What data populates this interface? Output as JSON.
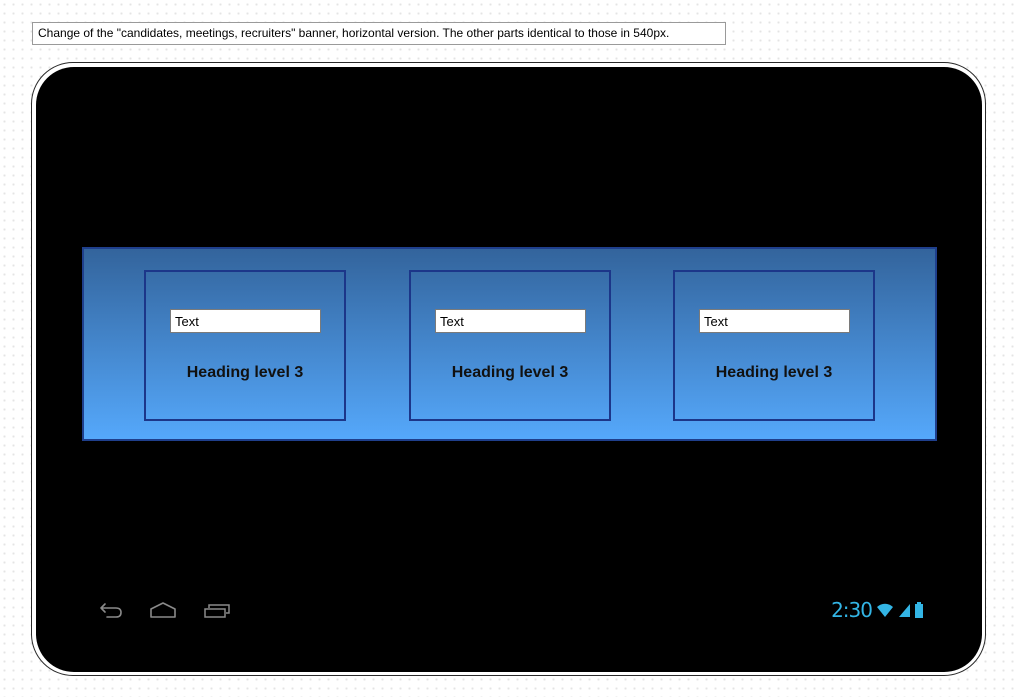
{
  "annotation": {
    "text": "Change of the \"candidates, meetings, recruiters\" banner, horizontal version. The other parts identical to those in 540px."
  },
  "banner": {
    "cards": [
      {
        "input_value": "Text",
        "heading": "Heading level 3"
      },
      {
        "input_value": "Text",
        "heading": "Heading level 3"
      },
      {
        "input_value": "Text",
        "heading": "Heading level 3"
      }
    ]
  },
  "status_bar": {
    "time": "2:30",
    "accent_color": "#33b5e5"
  },
  "colors": {
    "screen": "#000000",
    "banner_top": "#33649c",
    "banner_bottom": "#55a8fb",
    "card_border": "#1c3689"
  },
  "icons": {
    "nav": [
      "back-icon",
      "home-icon",
      "recent-apps-icon"
    ],
    "status": [
      "wifi-icon",
      "signal-icon",
      "battery-icon"
    ]
  }
}
